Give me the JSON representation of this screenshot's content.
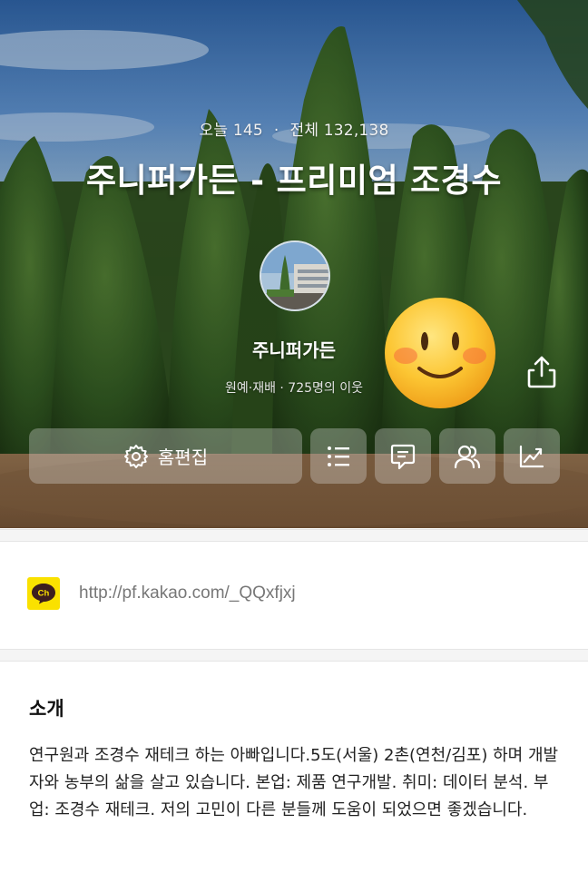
{
  "hero": {
    "today_label": "오늘 145",
    "total_label": "전체 132,138",
    "separator": "·",
    "title": "주니퍼가든 - 프리미엄 조경수",
    "profile_name": "주니퍼가든",
    "profile_meta": "원예·재배 · 725명의 이웃",
    "emoji": "slightly-smiling-face",
    "buttons": {
      "edit_label": "홈편집",
      "edit_icon": "gear-icon",
      "list_icon": "list-icon",
      "talk_icon": "talk-icon",
      "neighbors_icon": "people-icon",
      "stats_icon": "chart-icon",
      "share_icon": "share-icon"
    }
  },
  "channel": {
    "icon_text": "Ch",
    "url": "http://pf.kakao.com/_QQxfjxj",
    "colors": {
      "icon_bg": "#fae100"
    }
  },
  "intro": {
    "heading": "소개",
    "body": "연구원과 조경수 재테크 하는 아빠입니다.5도(서울) 2촌(연천/김포) 하며 개발자와 농부의 삶을 살고 있습니다.  본업: 제품 연구개발. 취미: 데이터 분석.  부업: 조경수 재테크. 저의 고민이 다른 분들께 도움이 되었으면 좋겠습니다."
  }
}
